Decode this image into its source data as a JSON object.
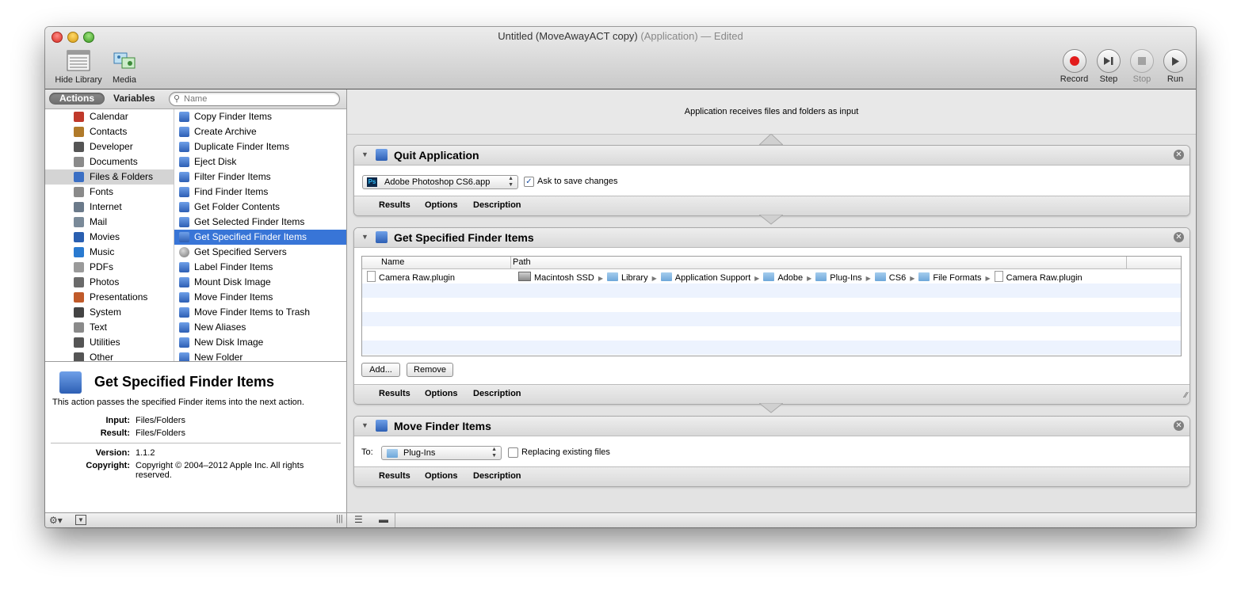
{
  "window": {
    "title_main": "Untitled (MoveAwayACT copy)",
    "title_kind": "(Application)",
    "title_state": "— Edited"
  },
  "toolbar": {
    "hide_library": "Hide Library",
    "media": "Media",
    "record": "Record",
    "step": "Step",
    "stop": "Stop",
    "run": "Run"
  },
  "library": {
    "tab_actions": "Actions",
    "tab_variables": "Variables",
    "search_placeholder": "Name",
    "categories": [
      {
        "label": "Calendar",
        "icon": "calendar-icon",
        "color": "#c0392b"
      },
      {
        "label": "Contacts",
        "icon": "contacts-icon",
        "color": "#b07a2a"
      },
      {
        "label": "Developer",
        "icon": "developer-icon",
        "color": "#555555"
      },
      {
        "label": "Documents",
        "icon": "documents-icon",
        "color": "#8a8a8a"
      },
      {
        "label": "Files & Folders",
        "icon": "finder-icon",
        "color": "#3b6fc4"
      },
      {
        "label": "Fonts",
        "icon": "fonts-icon",
        "color": "#8a8a8a"
      },
      {
        "label": "Internet",
        "icon": "internet-icon",
        "color": "#6b7a8a"
      },
      {
        "label": "Mail",
        "icon": "mail-icon",
        "color": "#7a8a99"
      },
      {
        "label": "Movies",
        "icon": "movies-icon",
        "color": "#2a5fb0"
      },
      {
        "label": "Music",
        "icon": "music-icon",
        "color": "#2a7ad0"
      },
      {
        "label": "PDFs",
        "icon": "pdf-icon",
        "color": "#9a9a9a"
      },
      {
        "label": "Photos",
        "icon": "photos-icon",
        "color": "#6a6a6a"
      },
      {
        "label": "Presentations",
        "icon": "presentations-icon",
        "color": "#c05a2a"
      },
      {
        "label": "System",
        "icon": "system-icon",
        "color": "#444444"
      },
      {
        "label": "Text",
        "icon": "text-icon",
        "color": "#8a8a8a"
      },
      {
        "label": "Utilities",
        "icon": "utilities-icon",
        "color": "#555555"
      },
      {
        "label": "Other",
        "icon": "other-icon",
        "color": "#555555"
      }
    ],
    "actions": [
      "Copy Finder Items",
      "Create Archive",
      "Duplicate Finder Items",
      "Eject Disk",
      "Filter Finder Items",
      "Find Finder Items",
      "Get Folder Contents",
      "Get Selected Finder Items",
      "Get Specified Finder Items",
      "Get Specified Servers",
      "Label Finder Items",
      "Mount Disk Image",
      "Move Finder Items",
      "Move Finder Items to Trash",
      "New Aliases",
      "New Disk Image",
      "New Folder"
    ],
    "selected_action_index": 8,
    "description": {
      "title": "Get Specified Finder Items",
      "text": "This action passes the specified Finder items into the next action.",
      "input_label": "Input:",
      "input_value": "Files/Folders",
      "result_label": "Result:",
      "result_value": "Files/Folders",
      "version_label": "Version:",
      "version_value": "1.1.2",
      "copyright_label": "Copyright:",
      "copyright_value": "Copyright © 2004–2012 Apple Inc.  All rights reserved."
    }
  },
  "workflow": {
    "input_banner": "Application receives files and folders as input",
    "footer_tabs": [
      "Results",
      "Options",
      "Description"
    ],
    "quit_app": {
      "title": "Quit Application",
      "app_popup": "Adobe Photoshop CS6.app",
      "ask_label": "Ask to save changes",
      "ask_checked": true
    },
    "get_items": {
      "title": "Get Specified Finder Items",
      "col_name": "Name",
      "col_path": "Path",
      "row_name": "Camera Raw.plugin",
      "path": [
        {
          "label": "Macintosh SSD",
          "kind": "drive"
        },
        {
          "label": "Library",
          "kind": "folder"
        },
        {
          "label": "Application Support",
          "kind": "folder"
        },
        {
          "label": "Adobe",
          "kind": "folder"
        },
        {
          "label": "Plug-Ins",
          "kind": "folder"
        },
        {
          "label": "CS6",
          "kind": "folder"
        },
        {
          "label": "File Formats",
          "kind": "folder"
        },
        {
          "label": "Camera Raw.plugin",
          "kind": "doc"
        }
      ],
      "add_label": "Add...",
      "remove_label": "Remove"
    },
    "move_items": {
      "title": "Move Finder Items",
      "to_label": "To:",
      "to_popup": "Plug-Ins",
      "replace_label": "Replacing existing files",
      "replace_checked": false
    }
  },
  "colors": {
    "selection": "#3875d7",
    "record_red": "#e21c1c"
  }
}
